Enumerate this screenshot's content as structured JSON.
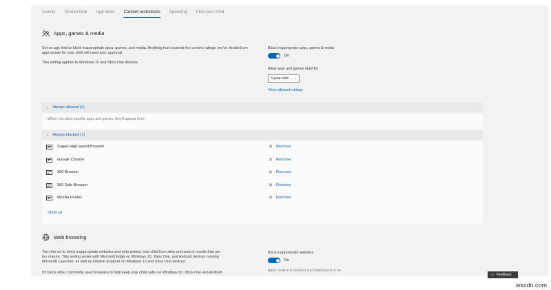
{
  "tabs": [
    {
      "label": "Activity"
    },
    {
      "label": "Screen time"
    },
    {
      "label": "App limits"
    },
    {
      "label": "Content restrictions"
    },
    {
      "label": "Spending"
    },
    {
      "label": "Find your child"
    }
  ],
  "apps_section": {
    "title": "Apps, games & media",
    "description": "Set an age limit to block inappropriate apps, games, and media. Anything that exceeds the content ratings you've decided are appropriate for your child will need your approval.",
    "applies_to": "This setting applies to Windows 10 and Xbox One devices.",
    "toggle_label": "Block inappropriate apps, games & media",
    "toggle_state": "On",
    "rating_label": "Allow apps and games rated for",
    "rating_value": "3-year-olds",
    "view_ratings_link": "View allowed ratings"
  },
  "always_allowed": {
    "header": "Always allowed (0)",
    "empty_message": "When you allow specific apps and games, they'll appear here."
  },
  "always_blocked": {
    "header": "Always blocked (7)",
    "items": [
      {
        "name": "Sogue High-speed Browser",
        "action": "Remove"
      },
      {
        "name": "Google Chrome",
        "action": "Remove"
      },
      {
        "name": "360 Browser",
        "action": "Remove"
      },
      {
        "name": "360 Safe Browser",
        "action": "Remove"
      },
      {
        "name": "Mozilla Firefox",
        "action": "Remove"
      }
    ],
    "show_all": "Show all"
  },
  "web_section": {
    "title": "Web browsing",
    "description_line1": "Turn this on to block inappropriate websites and help protect your child from sites and search results that are",
    "description_line2": "too mature. This setting works with Microsoft Edge on Windows 10, Xbox One, and Android devices running",
    "description_line3": "Microsoft Launcher, as well as Internet Explorer on Windows 10 and Xbox One devices.",
    "description_line4": "It'll block other commonly used browsers to help keep your child safer on Windows 10, Xbox One and Android",
    "toggle_label": "Block inappropriate websites",
    "toggle_state": "On",
    "note": "Adult content is blocked and SafeSearch is on"
  },
  "feedback": {
    "label": "Feedback"
  },
  "watermark": "wsxdn.com",
  "colors": {
    "accent": "#0067c0",
    "background": "#f2f2f2",
    "panel": "#fbfbfb"
  }
}
